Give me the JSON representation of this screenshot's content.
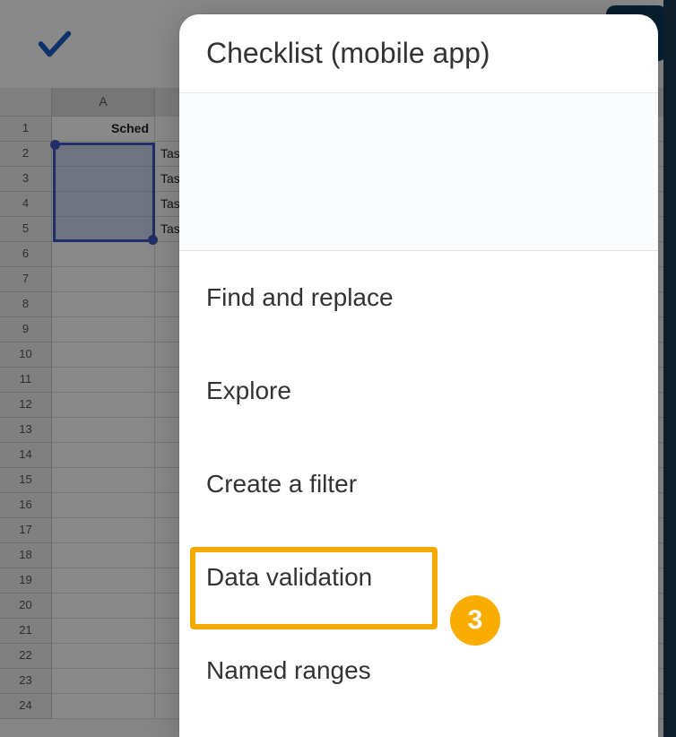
{
  "topbar": {
    "confirm_icon": "check-icon"
  },
  "sheet": {
    "col_header": "A",
    "rows": [
      {
        "n": "1",
        "a": "Sched",
        "b": ""
      },
      {
        "n": "2",
        "a": "",
        "b": "Tas"
      },
      {
        "n": "3",
        "a": "",
        "b": "Tas"
      },
      {
        "n": "4",
        "a": "",
        "b": "Tas"
      },
      {
        "n": "5",
        "a": "",
        "b": "Tas"
      },
      {
        "n": "6",
        "a": "",
        "b": ""
      },
      {
        "n": "7",
        "a": "",
        "b": ""
      },
      {
        "n": "8",
        "a": "",
        "b": ""
      },
      {
        "n": "9",
        "a": "",
        "b": ""
      },
      {
        "n": "10",
        "a": "",
        "b": ""
      },
      {
        "n": "11",
        "a": "",
        "b": ""
      },
      {
        "n": "12",
        "a": "",
        "b": ""
      },
      {
        "n": "13",
        "a": "",
        "b": ""
      },
      {
        "n": "14",
        "a": "",
        "b": ""
      },
      {
        "n": "15",
        "a": "",
        "b": ""
      },
      {
        "n": "16",
        "a": "",
        "b": ""
      },
      {
        "n": "17",
        "a": "",
        "b": ""
      },
      {
        "n": "18",
        "a": "",
        "b": ""
      },
      {
        "n": "19",
        "a": "",
        "b": ""
      },
      {
        "n": "20",
        "a": "",
        "b": ""
      },
      {
        "n": "21",
        "a": "",
        "b": ""
      },
      {
        "n": "22",
        "a": "",
        "b": ""
      },
      {
        "n": "23",
        "a": "",
        "b": ""
      },
      {
        "n": "24",
        "a": "",
        "b": ""
      }
    ]
  },
  "popup": {
    "title": "Checklist (mobile app)",
    "items": [
      "Find and replace",
      "Explore",
      "Create a filter",
      "Data validation",
      "Named ranges"
    ]
  },
  "annotation": {
    "step_number": "3",
    "highlight_target": "Data validation"
  },
  "colors": {
    "highlight": "#f5a900",
    "selection": "#3a57c9"
  }
}
